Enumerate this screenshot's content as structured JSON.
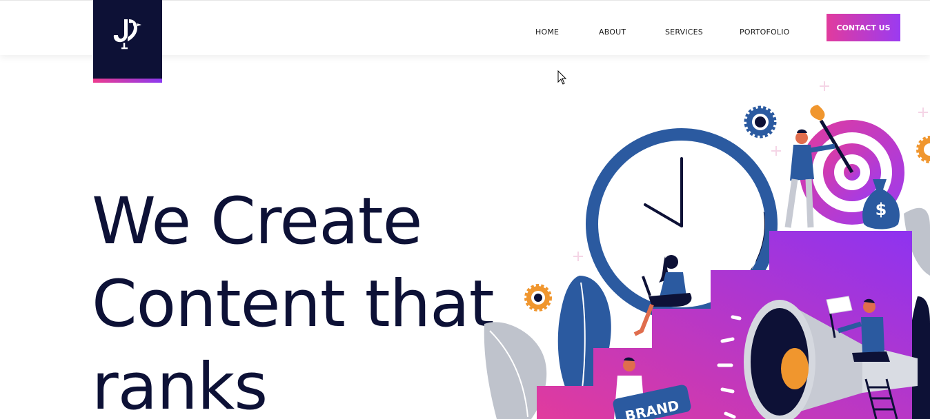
{
  "nav": {
    "home": "HOME",
    "about": "ABOUT",
    "services": "SERVICES",
    "portfolio": "PORTOFOLIO",
    "contact": "CONTACT US"
  },
  "hero": {
    "line1": "We Create",
    "line2": "Content that",
    "line3": "ranks"
  },
  "illustration": {
    "brand_sign": "BRAND",
    "money_symbol": "$"
  },
  "colors": {
    "navy": "#0d1136",
    "accent_pink": "#e13b9d",
    "accent_purple": "#9b3bf1",
    "clock_blue": "#2b5aa0",
    "gear_orange": "#f0962e"
  }
}
